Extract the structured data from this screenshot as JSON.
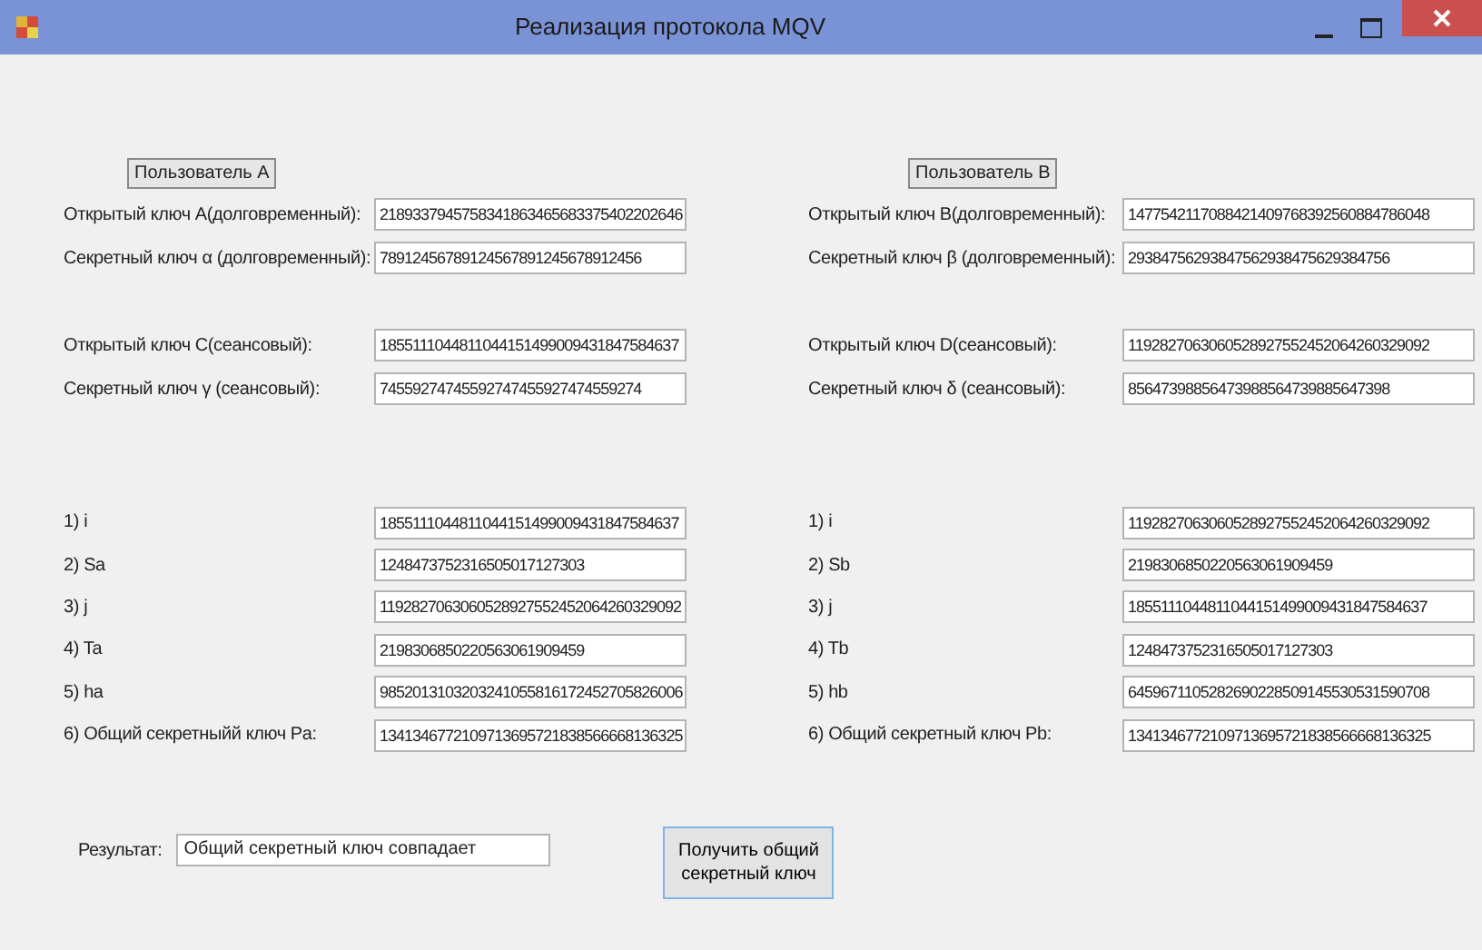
{
  "window": {
    "title": "Реализация протокола MQV"
  },
  "panels": [
    {
      "header": "Пользователь A",
      "key_groups": [
        [
          {
            "label": "Открытый ключ A(долговременный):",
            "value": "2189337945758341863465683375402202646"
          },
          {
            "label": "Секретный ключ α (долговременный):",
            "value": "78912456789124567891245678912456"
          }
        ],
        [
          {
            "label": "Открытый ключ C(сеансовый):",
            "value": "1855111044811044151499009431847584637"
          },
          {
            "label": "Секретный ключ γ (сеансовый):",
            "value": "74559274745592747455927474559274"
          }
        ]
      ],
      "steps": [
        {
          "label": "1) i",
          "value": "1855111044811044151499009431847584637"
        },
        {
          "label": "2) Sa",
          "value": "1248473752316505017127303"
        },
        {
          "label": "3) j",
          "value": "1192827063060528927552452064260329092"
        },
        {
          "label": "4) Ta",
          "value": "2198306850220563061909459"
        },
        {
          "label": "5) ha",
          "value": "9852013103203241055816172452705826006"
        },
        {
          "label": "6) Общий секретныйй ключ Pa:",
          "value": "1341346772109713695721838566668136325"
        }
      ]
    },
    {
      "header": "Пользователь B",
      "key_groups": [
        [
          {
            "label": "Открытый ключ B(долговременный):",
            "value": "1477542117088421409768392560884786048"
          },
          {
            "label": "Секретный ключ β (долговременный):",
            "value": "29384756293847562938475629384756"
          }
        ],
        [
          {
            "label": "Открытый ключ D(сеансовый):",
            "value": "1192827063060528927552452064260329092"
          },
          {
            "label": "Секретный ключ δ (сеансовый):",
            "value": "85647398856473988564739885647398"
          }
        ]
      ],
      "steps": [
        {
          "label": "1) i",
          "value": "1192827063060528927552452064260329092"
        },
        {
          "label": "2) Sb",
          "value": "2198306850220563061909459"
        },
        {
          "label": "3) j",
          "value": "1855111044811044151499009431847584637"
        },
        {
          "label": "4) Tb",
          "value": "1248473752316505017127303"
        },
        {
          "label": "5) hb",
          "value": "6459671105282690228509145530531590708"
        },
        {
          "label": "6) Общий секретный ключ Pb:",
          "value": "1341346772109713695721838566668136325"
        }
      ]
    }
  ],
  "result": {
    "label": "Результат:",
    "value": "Общий секретный ключ совпадает"
  },
  "action_button": "Получить общий секретный ключ"
}
